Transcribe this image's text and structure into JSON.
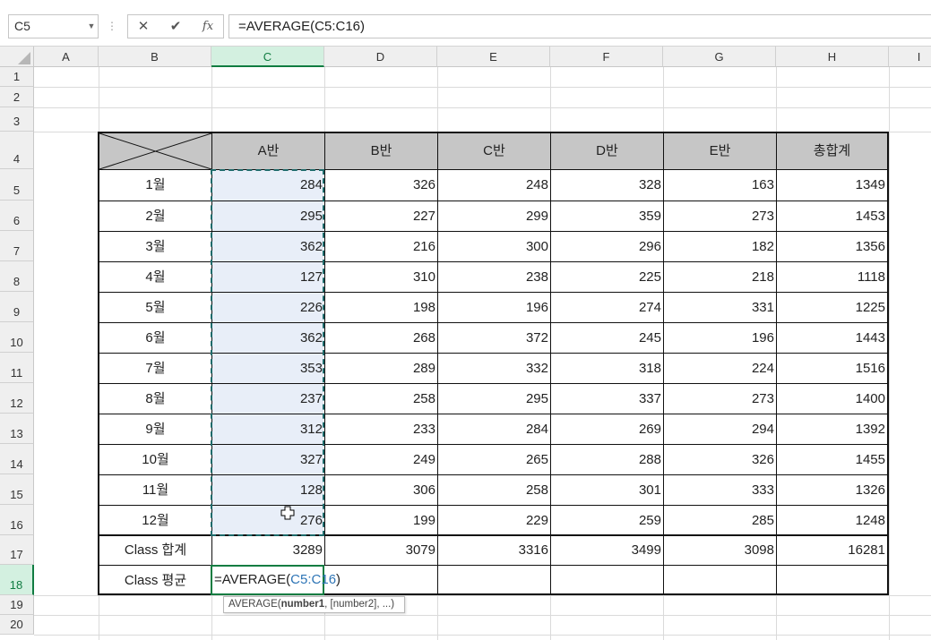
{
  "name_box": {
    "value": "C5"
  },
  "formula_bar": {
    "cancel_icon": "✕",
    "enter_icon": "✔",
    "fx_icon": "fx",
    "value": "=AVERAGE(C5:C16)"
  },
  "columns": [
    "A",
    "B",
    "C",
    "D",
    "E",
    "F",
    "G",
    "H",
    "I"
  ],
  "rows": [
    "1",
    "2",
    "3",
    "4",
    "5",
    "6",
    "7",
    "8",
    "9",
    "10",
    "11",
    "12",
    "13",
    "14",
    "15",
    "16",
    "17",
    "18",
    "19",
    "20"
  ],
  "table": {
    "headers": [
      "A반",
      "B반",
      "C반",
      "D반",
      "E반",
      "총합계"
    ],
    "months": [
      "1월",
      "2월",
      "3월",
      "4월",
      "5월",
      "6월",
      "7월",
      "8월",
      "9월",
      "10월",
      "11월",
      "12월"
    ],
    "data": [
      [
        "284",
        "326",
        "248",
        "328",
        "163",
        "1349"
      ],
      [
        "295",
        "227",
        "299",
        "359",
        "273",
        "1453"
      ],
      [
        "362",
        "216",
        "300",
        "296",
        "182",
        "1356"
      ],
      [
        "127",
        "310",
        "238",
        "225",
        "218",
        "1118"
      ],
      [
        "226",
        "198",
        "196",
        "274",
        "331",
        "1225"
      ],
      [
        "362",
        "268",
        "372",
        "245",
        "196",
        "1443"
      ],
      [
        "353",
        "289",
        "332",
        "318",
        "224",
        "1516"
      ],
      [
        "237",
        "258",
        "295",
        "337",
        "273",
        "1400"
      ],
      [
        "312",
        "233",
        "284",
        "269",
        "294",
        "1392"
      ],
      [
        "327",
        "249",
        "265",
        "288",
        "326",
        "1455"
      ],
      [
        "128",
        "306",
        "258",
        "301",
        "333",
        "1326"
      ],
      [
        "276",
        "199",
        "229",
        "259",
        "285",
        "1248"
      ]
    ],
    "sum_label": "Class 합계",
    "sums": [
      "3289",
      "3079",
      "3316",
      "3499",
      "3098",
      "16281"
    ],
    "avg_label": "Class 평균",
    "edit_prefix": "=AVERAGE(",
    "edit_ref": "C5:C16",
    "edit_suffix": ")"
  },
  "tooltip": {
    "fn": "AVERAGE(",
    "arg1": "number1",
    "rest": ", [number2], ...)"
  },
  "colors": {
    "accent": "#107c41",
    "ref": "#2e75b6",
    "header_fill": "#c6c6c6",
    "selection": "#e8eef8"
  }
}
